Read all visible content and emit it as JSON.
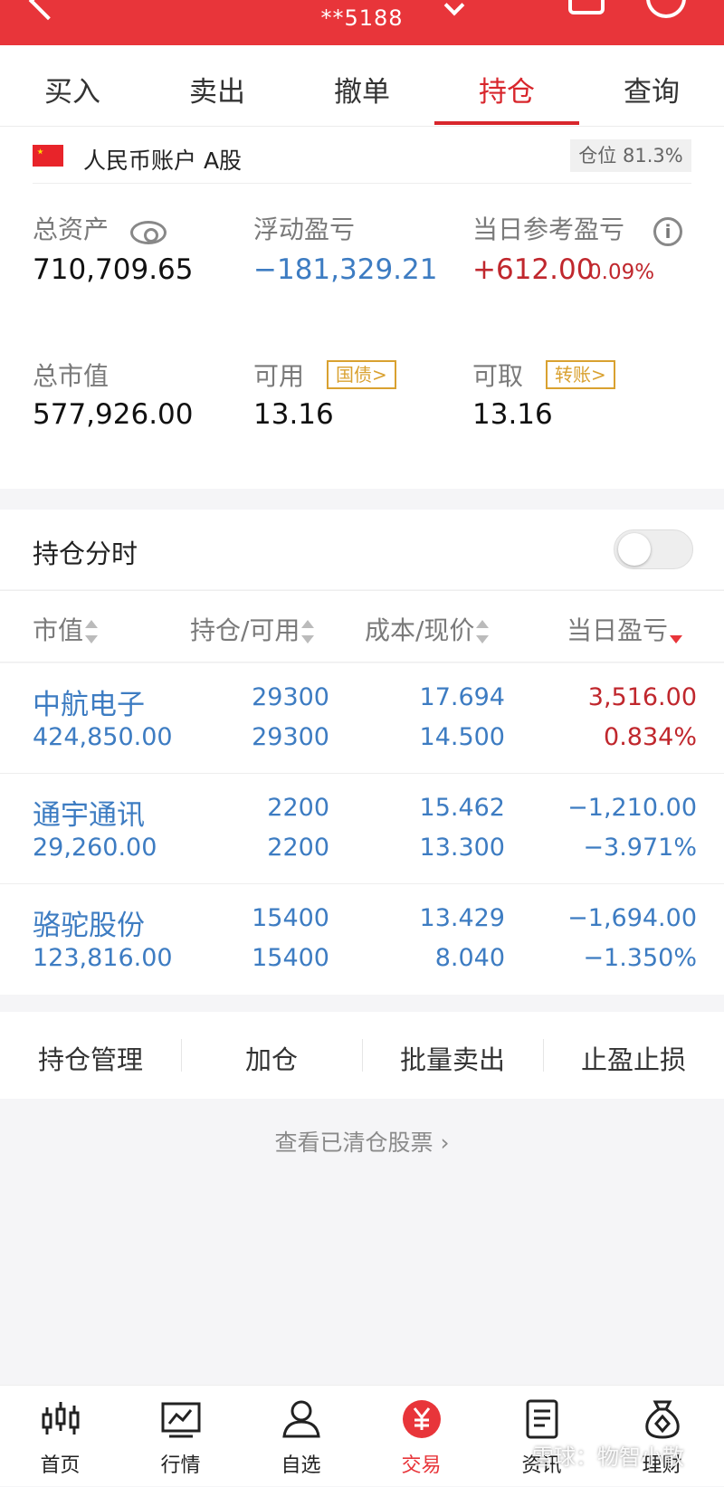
{
  "header": {
    "title": "**5188"
  },
  "tabs": [
    "买入",
    "卖出",
    "撤单",
    "持仓",
    "查询"
  ],
  "account": {
    "name": "人民币账户 A股",
    "position": "仓位 81.3%"
  },
  "summary": {
    "total_assets_label": "总资产",
    "total_assets": "710,709.65",
    "floating_pl_label": "浮动盈亏",
    "floating_pl": "−181,329.21",
    "daily_pl_label": "当日参考盈亏",
    "daily_pl": "+612.00",
    "daily_pl_pct": "0.09%",
    "market_value_label": "总市值",
    "market_value": "577,926.00",
    "available_label": "可用",
    "available_tag": "国债>",
    "available": "13.16",
    "withdrawable_label": "可取",
    "withdrawable_tag": "转账>",
    "withdrawable": "13.16"
  },
  "section": {
    "title": "持仓分时"
  },
  "table": {
    "headers": [
      "市值",
      "持仓/可用",
      "成本/现价",
      "当日盈亏"
    ]
  },
  "positions": [
    {
      "name": "中航电子",
      "market_value": "424,850.00",
      "holding": "29300",
      "available": "29300",
      "cost": "17.694",
      "price": "14.500",
      "pl": "3,516.00",
      "pl_pct": "0.834%"
    },
    {
      "name": "通宇通讯",
      "market_value": "29,260.00",
      "holding": "2200",
      "available": "2200",
      "cost": "15.462",
      "price": "13.300",
      "pl": "−1,210.00",
      "pl_pct": "−3.971%"
    },
    {
      "name": "骆驼股份",
      "market_value": "123,816.00",
      "holding": "15400",
      "available": "15400",
      "cost": "13.429",
      "price": "8.040",
      "pl": "−1,694.00",
      "pl_pct": "−1.350%"
    }
  ],
  "actions": [
    "持仓管理",
    "加仓",
    "批量卖出",
    "止盈止损"
  ],
  "cleared_link": "查看已清仓股票",
  "nav": [
    {
      "label": "首页",
      "icon": "candlestick-icon"
    },
    {
      "label": "行情",
      "icon": "chart-icon"
    },
    {
      "label": "自选",
      "icon": "user-icon"
    },
    {
      "label": "交易",
      "icon": "yuan-icon"
    },
    {
      "label": "资讯",
      "icon": "document-icon"
    },
    {
      "label": "理财",
      "icon": "money-bag-icon"
    }
  ],
  "watermark": "雪球：物智小散",
  "colors": {
    "brand": "#e8353a",
    "up": "#c0272d",
    "down": "#3d7cc2"
  }
}
